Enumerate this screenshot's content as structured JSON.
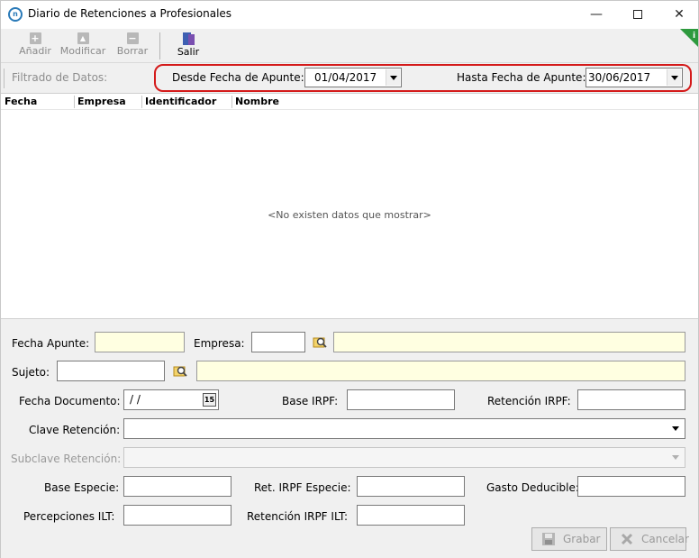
{
  "window": {
    "title": "Diario de Retenciones a Profesionales",
    "minimize": "—",
    "close": "✕"
  },
  "toolbar": {
    "add_label": "Añadir",
    "modify_label": "Modificar",
    "delete_label": "Borrar",
    "exit_label": "Salir"
  },
  "filter": {
    "label": "Filtrado de Datos:",
    "from_label": "Desde Fecha de Apunte:",
    "from_value": "01/04/2017",
    "to_label": "Hasta Fecha de Apunte:",
    "to_value": "30/06/2017"
  },
  "grid": {
    "columns": [
      "Fecha",
      "Empresa",
      "Identificador",
      "Nombre"
    ],
    "empty_message": "<No existen datos que mostrar>"
  },
  "form": {
    "fecha_apunte_label": "Fecha Apunte:",
    "empresa_label": "Empresa:",
    "sujeto_label": "Sujeto:",
    "fecha_documento_label": "Fecha Documento:",
    "fecha_documento_value": " / /",
    "calendar_glyph": "15",
    "base_irpf_label": "Base IRPF:",
    "retencion_irpf_label": "Retención IRPF:",
    "clave_retencion_label": "Clave Retención:",
    "subclave_retencion_label": "Subclave Retención:",
    "base_especie_label": "Base Especie:",
    "ret_irpf_especie_label": "Ret. IRPF Especie:",
    "gasto_deducible_label": "Gasto Deducible:",
    "percepciones_ilt_label": "Percepciones ILT:",
    "retencion_irpf_ilt_label": "Retención IRPF ILT:",
    "save_label": "Grabar",
    "cancel_label": "Cancelar"
  },
  "colors": {
    "highlight_oval": "#d41a1a",
    "yellow_field": "#ffffe1",
    "info_badge": "#2e9a3e"
  }
}
